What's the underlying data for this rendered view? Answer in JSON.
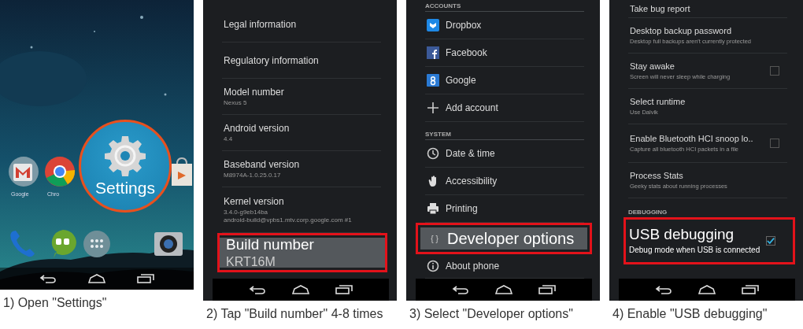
{
  "panels": [
    {
      "kind": "home",
      "apps": [
        {
          "label": "Google"
        },
        {
          "label": "Chro"
        }
      ],
      "highlight": {
        "label": "Settings"
      },
      "caption": "1) Open \"Settings\""
    },
    {
      "kind": "list",
      "items": [
        {
          "kind": "entry",
          "title": "Legal information",
          "selected": false
        },
        {
          "kind": "entry",
          "title": "Regulatory information",
          "selected": false
        },
        {
          "kind": "entry",
          "title": "Model number",
          "summary": "Nexus 5",
          "selected": false
        },
        {
          "kind": "entry",
          "title": "Android version",
          "summary": "4.4",
          "selected": false
        },
        {
          "kind": "entry",
          "title": "Baseband version",
          "summary": "M8974A-1.0.25.0.17",
          "selected": false
        },
        {
          "kind": "entry",
          "title": "Kernel version",
          "summary": "3.4.0-g9eb14ba\nandroid-build@vpbs1.mtv.corp.google.com #1",
          "selected": false
        },
        {
          "kind": "entry",
          "title": "Build number",
          "summary": "KRT16M",
          "selected": true
        }
      ],
      "caption": "2) Tap \"Build number\" 4-8 times"
    },
    {
      "kind": "list",
      "items": [
        {
          "kind": "header",
          "title": "ACCOUNTS"
        },
        {
          "kind": "entry",
          "title": "Dropbox",
          "selected": false
        },
        {
          "kind": "entry",
          "title": "Facebook",
          "selected": false
        },
        {
          "kind": "entry",
          "title": "Google",
          "selected": false
        },
        {
          "kind": "entry",
          "title": "Add account",
          "selected": false
        },
        {
          "kind": "header",
          "title": "SYSTEM"
        },
        {
          "kind": "entry",
          "title": "Date & time",
          "selected": false
        },
        {
          "kind": "entry",
          "title": "Accessibility",
          "selected": false
        },
        {
          "kind": "entry",
          "title": "Printing",
          "selected": false
        },
        {
          "kind": "entry",
          "title": "Developer options",
          "glyph": "{ }",
          "selected": true
        },
        {
          "kind": "entry",
          "title": "About phone",
          "selected": false
        }
      ],
      "caption": "3) Select \"Developer options\""
    },
    {
      "kind": "list",
      "items": [
        {
          "kind": "entry",
          "title": "Take bug report",
          "selected": false
        },
        {
          "kind": "entry",
          "title": "Desktop backup password",
          "summary": "Desktop full backups aren't currently protected",
          "selected": false
        },
        {
          "kind": "check",
          "title": "Stay awake",
          "summary": "Screen will never sleep while charging",
          "checked": false,
          "selected": false
        },
        {
          "kind": "entry",
          "title": "Select runtime",
          "summary": "Use Dalvik",
          "selected": false
        },
        {
          "kind": "check",
          "title": "Enable Bluetooth HCI snoop lo..",
          "summary": "Capture all bluetooth HCI packets in a file",
          "checked": false,
          "selected": false
        },
        {
          "kind": "entry",
          "title": "Process Stats",
          "summary": "Geeky stats about running processes",
          "selected": false
        },
        {
          "kind": "header",
          "title": "DEBUGGING"
        },
        {
          "kind": "check",
          "title": "USB debugging",
          "summary": "Debug mode when USB is connected",
          "checked": true,
          "selected": true
        }
      ],
      "caption": "4) Enable \"USB debugging\""
    }
  ]
}
